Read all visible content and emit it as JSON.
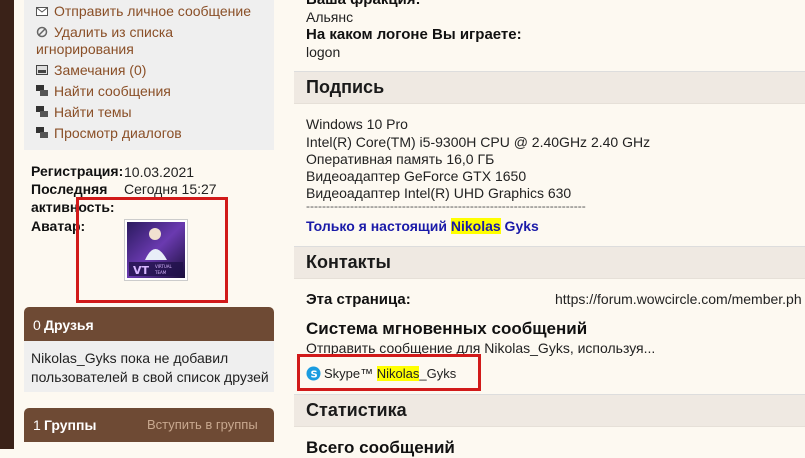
{
  "sidebar": {
    "actions": [
      {
        "label": "Отправить личное сообщение",
        "icon": "envelope-icon"
      },
      {
        "label": "Удалить из списка",
        "label2": "игнорирования",
        "icon": "remove-ignore-icon"
      },
      {
        "label": "Замечания (0)",
        "icon": "infractions-icon"
      },
      {
        "label": "Найти сообщения",
        "icon": "find-posts-icon"
      },
      {
        "label": "Найти темы",
        "icon": "find-threads-icon"
      },
      {
        "label": "Просмотр диалогов",
        "icon": "conversations-icon"
      }
    ],
    "info": {
      "registration_label": "Регистрация:",
      "registration_value": "10.03.2021",
      "last_activity_label_1": "Последняя",
      "last_activity_label_2": "активность:",
      "last_activity_value": "Сегодня 15:27",
      "avatar_label": "Аватар:",
      "avatar_logo": "VT",
      "avatar_caption_1": "VIRTUAL",
      "avatar_caption_2": "TEAM"
    },
    "friends": {
      "count": "0",
      "title": "Друзья",
      "text_1": "Nikolas_Gyks пока не добавил",
      "text_2": "пользователей в свой список друзей"
    },
    "groups": {
      "count": "1",
      "title": "Группы",
      "join": "Вступить в группы"
    }
  },
  "main": {
    "top": {
      "faction_label": "Ваша фракция:",
      "faction_value": "Альянс",
      "logon_label": "На каком логоне Вы играете:",
      "logon_value": "logon"
    },
    "signature": {
      "title": "Подпись",
      "lines": [
        "Windows 10 Pro",
        "Intel(R) Core(TM) i5-9300H CPU @ 2.40GHz 2.40 GHz",
        "Оперативная память 16,0 ГБ",
        "Видеоадаптер GeForce GTX 1650",
        "Видеоадаптер Intel(R) UHD Graphics 630"
      ],
      "separator": "----------------------------------------------------------------------",
      "tagline_prefix": "Только я настоящий ",
      "tagline_highlight": "Nikolas",
      "tagline_suffix": " Gyks"
    },
    "contacts": {
      "title": "Контакты",
      "page_label": "Эта страница:",
      "page_url": "https://forum.wowcircle.com/member.ph",
      "im_title": "Система мгновенных сообщений",
      "im_text": "Отправить сообщение для Nikolas_Gyks, используя...",
      "skype_label": "Skype™",
      "skype_highlight": "Nikolas",
      "skype_suffix": "_Gyks"
    },
    "stats": {
      "title": "Статистика",
      "total_posts": "Всего сообщений"
    }
  },
  "colors": {
    "accent": "#6e4a34",
    "link": "#8a4f27",
    "highlight": "#ffff00",
    "annotation": "#d11a1a",
    "signature_link": "#1a1aa8"
  }
}
